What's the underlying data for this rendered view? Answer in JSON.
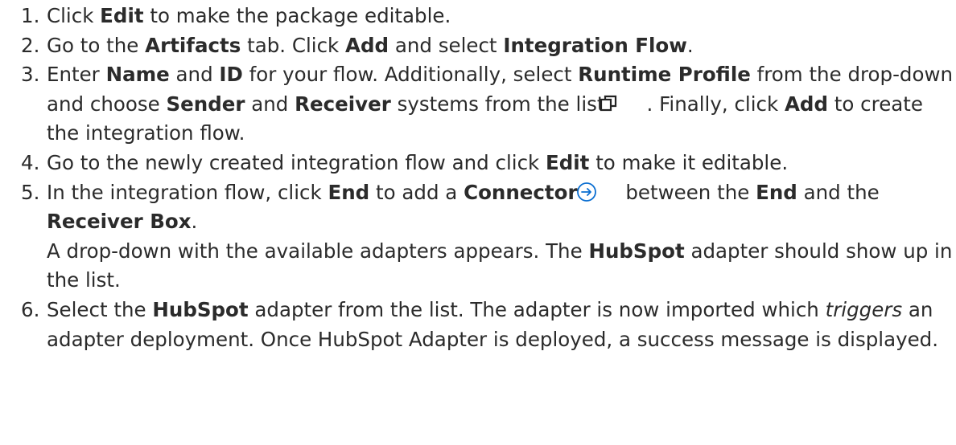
{
  "steps": [
    {
      "number": "1.",
      "t1": "Click ",
      "b1": "Edit",
      "t2": " to make the package editable."
    },
    {
      "number": "2.",
      "t1": "Go to the ",
      "b1": "Artifacts",
      "t2": " tab. Click ",
      "b2": "Add",
      "t3": " and select ",
      "b3": "Integration Flow",
      "t4": "."
    },
    {
      "number": "3.",
      "t1": "Enter ",
      "b1": "Name",
      "t2": " and ",
      "b2": "ID",
      "t3": " for your flow. Additionally, select ",
      "b3": "Runtime Profile",
      "t4": " from the drop-down and choose ",
      "b4": "Sender",
      "t5": " and ",
      "b5": "Receiver",
      "t6": " systems from the list",
      "icon": "external-link-icon",
      "t7": ". Finally, click ",
      "b6": "Add",
      "t8": " to create the integration flow."
    },
    {
      "number": "4.",
      "t1": "Go to the newly created integration flow and click ",
      "b1": "Edit",
      "t2": " to make it editable."
    },
    {
      "number": "5.",
      "t1": "In the integration flow, click ",
      "b1": "End",
      "t2": " to add a ",
      "b2": "Connector",
      "icon": "arrow-right-circle-icon",
      "t3": " between the ",
      "b3": "End",
      "t4": " and the ",
      "b4": "Receiver Box",
      "t5": ".",
      "p2_t1": "A drop-down with the available adapters appears. The ",
      "p2_b1": "HubSpot",
      "p2_t2": " adapter should show up in the list."
    },
    {
      "number": "6.",
      "t1": "Select the ",
      "b1": "HubSpot",
      "t2": " adapter from the list. The adapter is now imported which ",
      "i1": "triggers",
      "t3": " an adapter deployment. Once HubSpot Adapter is deployed, a success message is displayed."
    }
  ],
  "colors": {
    "text": "#2b2b2b",
    "icon": "#0a6ed1"
  }
}
